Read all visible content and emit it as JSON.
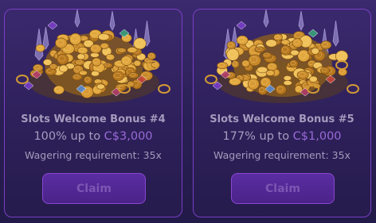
{
  "cards": [
    {
      "title": "Slots Welcome Bonus #4",
      "offer_prefix": "100% up to ",
      "offer_amount": "C$3,000",
      "wagering": "Wagering requirement: 35x",
      "claim_label": "Claim",
      "image": "treasure-coins-image"
    },
    {
      "title": "Slots Welcome Bonus #5",
      "offer_prefix": "177% up to ",
      "offer_amount": "C$1,000",
      "wagering": "Wagering requirement: 35x",
      "claim_label": "Claim",
      "image": "treasure-coins-image"
    }
  ],
  "colors": {
    "accent": "#9a6ad8",
    "card_border": "#7a3fc4",
    "button_bg": "#5a2da2",
    "text_muted": "#a59bbd"
  }
}
